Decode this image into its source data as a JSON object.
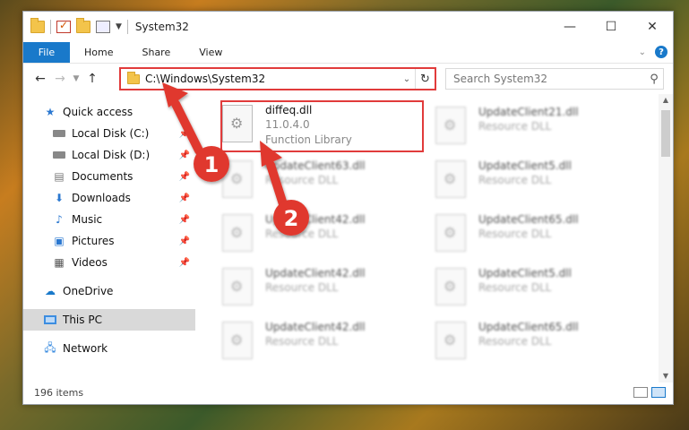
{
  "window": {
    "title": "System32",
    "controls": {
      "minimize": "—",
      "maximize": "☐",
      "close": "✕"
    }
  },
  "ribbon": {
    "file_label": "File",
    "tabs": [
      "Home",
      "Share",
      "View"
    ]
  },
  "navbar": {
    "address": "C:\\Windows\\System32",
    "search_placeholder": "Search System32"
  },
  "sidebar": {
    "items": [
      {
        "label": "Quick access",
        "icon": "star-icon",
        "level": 0
      },
      {
        "label": "Local Disk (C:)",
        "icon": "drive-icon",
        "level": 1,
        "pinned": true
      },
      {
        "label": "Local Disk (D:)",
        "icon": "drive-icon",
        "level": 1,
        "pinned": true
      },
      {
        "label": "Documents",
        "icon": "documents-icon",
        "level": 1,
        "pinned": true
      },
      {
        "label": "Downloads",
        "icon": "downloads-icon",
        "level": 1,
        "pinned": true
      },
      {
        "label": "Music",
        "icon": "music-icon",
        "level": 1,
        "pinned": true
      },
      {
        "label": "Pictures",
        "icon": "pictures-icon",
        "level": 1,
        "pinned": true
      },
      {
        "label": "Videos",
        "icon": "videos-icon",
        "level": 1,
        "pinned": true
      },
      {
        "label": "OneDrive",
        "icon": "cloud-icon",
        "level": 0
      },
      {
        "label": "This PC",
        "icon": "computer-icon",
        "level": 0,
        "selected": true
      },
      {
        "label": "Network",
        "icon": "network-icon",
        "level": 0
      }
    ]
  },
  "files": [
    {
      "name": "diffeq.dll",
      "line2": "11.0.4.0",
      "line3": "Function Library"
    },
    {
      "name": "UpdateClient21.dll",
      "line2": "Resource DLL"
    },
    {
      "name": "UpdateClient63.dll",
      "line2": "Resource DLL"
    },
    {
      "name": "UpdateClient5.dll",
      "line2": "Resource DLL"
    },
    {
      "name": "UpdateClient42.dll",
      "line2": "Resource DLL"
    },
    {
      "name": "UpdateClient65.dll",
      "line2": "Resource DLL"
    },
    {
      "name": "UpdateClient42.dll",
      "line2": "Resource DLL"
    },
    {
      "name": "UpdateClient5.dll",
      "line2": "Resource DLL"
    },
    {
      "name": "UpdateClient42.dll",
      "line2": "Resource DLL"
    },
    {
      "name": "UpdateClient65.dll",
      "line2": "Resource DLL"
    }
  ],
  "status": {
    "item_count": "196 items"
  },
  "annotations": {
    "badge1": "1",
    "badge2": "2"
  },
  "colors": {
    "accent": "#1979ca",
    "highlight": "#e13b3b"
  }
}
